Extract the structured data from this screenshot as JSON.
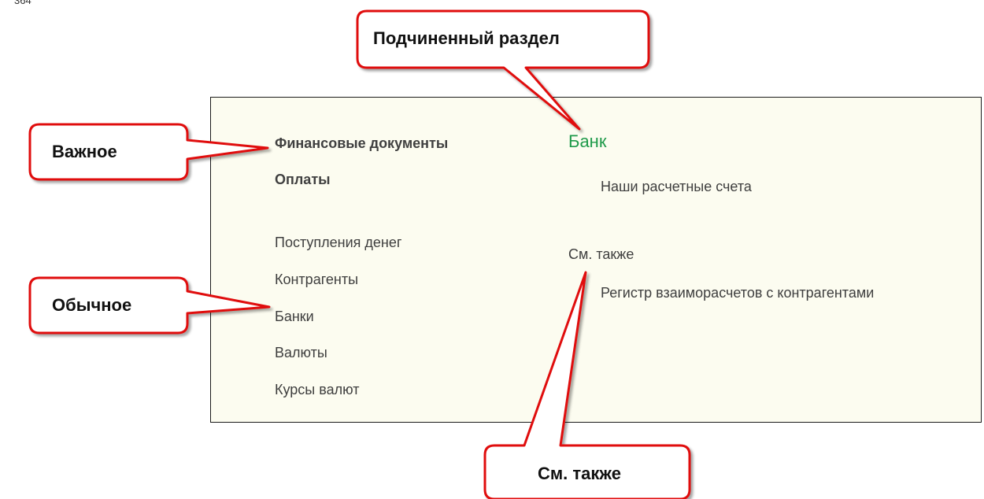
{
  "page_number": "364",
  "panel": {
    "left_column": {
      "important_items": [
        "Финансовые документы",
        "Оплаты"
      ],
      "regular_items": [
        "Поступления денег",
        "Контрагенты",
        "Банки",
        "Валюты",
        "Курсы валют"
      ]
    },
    "right_column": {
      "subsection_title": "Банк",
      "subsection_items": [
        "Наши расчетные счета"
      ],
      "see_also_title": "См. также",
      "see_also_items": [
        "Регистр взаиморасчетов с контрагентами"
      ]
    }
  },
  "callouts": {
    "subordinate_section": "Подчиненный раздел",
    "important": "Важное",
    "regular": "Обычное",
    "see_also": "См. также"
  },
  "colors": {
    "panel_background": "#fcfcf0",
    "subsection_title": "#1f9a4a",
    "callout_border": "#e01010",
    "callout_fill": "#ffffff"
  }
}
